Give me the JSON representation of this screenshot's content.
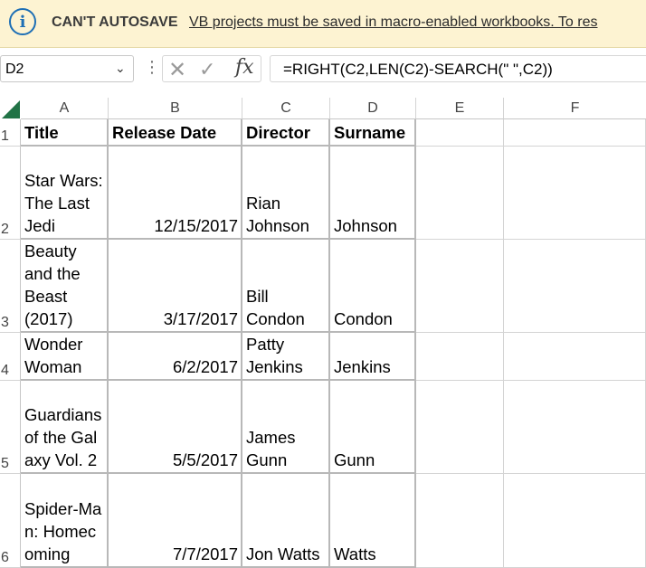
{
  "infobar": {
    "title": "CAN'T AUTOSAVE",
    "message": "VB projects must be saved in macro-enabled workbooks. To res",
    "icon": "info-icon"
  },
  "formula_bar": {
    "name_box": "D2",
    "formula": "=RIGHT(C2,LEN(C2)-SEARCH(\" \",C2))"
  },
  "columns": [
    "A",
    "B",
    "C",
    "D",
    "E",
    "F"
  ],
  "rows": [
    "1",
    "2",
    "3",
    "4",
    "5",
    "6"
  ],
  "header": {
    "title": "Title",
    "release_date": "Release Date",
    "director": "Director",
    "surname": "Surname"
  },
  "data": [
    {
      "title": "Star Wars: The Last Jedi",
      "release_date": "12/15/2017",
      "director": "Rian Johnson",
      "surname": "Johnson"
    },
    {
      "title": "Beauty and the Beast (2017)",
      "release_date": "3/17/2017",
      "director": "Bill Condon",
      "surname": "Condon"
    },
    {
      "title": "Wonder Woman",
      "release_date": "6/2/2017",
      "director": "Patty Jenkins",
      "surname": "Jenkins"
    },
    {
      "title": "Guardians of the Galaxy Vol. 2",
      "release_date": "5/5/2017",
      "director": "James Gunn",
      "surname": "Gunn"
    },
    {
      "title": "Spider-Man: Homecoming",
      "release_date": "7/7/2017",
      "director": "Jon Watts",
      "surname": "Watts"
    }
  ],
  "colors": {
    "infobar_bg": "#fdf3d2",
    "accent_green": "#217346",
    "info_blue": "#1e6fb5"
  }
}
